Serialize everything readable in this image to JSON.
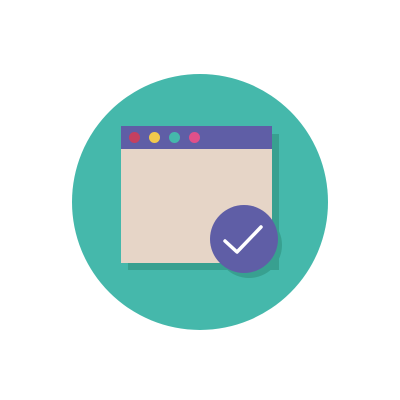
{
  "illustration": {
    "kind": "browser-window-verified-icon",
    "icons": {
      "background": "teal-circle",
      "window": "browser-window-icon",
      "badge": "checkmark-badge-icon"
    },
    "colors": {
      "page_background": "#ffffff",
      "circle": "#45b8ab",
      "window_shadow": "#38a090",
      "titlebar": "#5f5ea6",
      "content": "#e6d5c7",
      "badge": "#5f5ea6",
      "badge_shadow": "#38a090",
      "checkmark": "#ffffff"
    },
    "window_dots": [
      {
        "name": "close-dot",
        "color": "#c44060"
      },
      {
        "name": "minimize-dot",
        "color": "#f2c94c"
      },
      {
        "name": "maximize-dot",
        "color": "#45b8ab"
      },
      {
        "name": "extra-dot",
        "color": "#e0508a"
      }
    ]
  }
}
